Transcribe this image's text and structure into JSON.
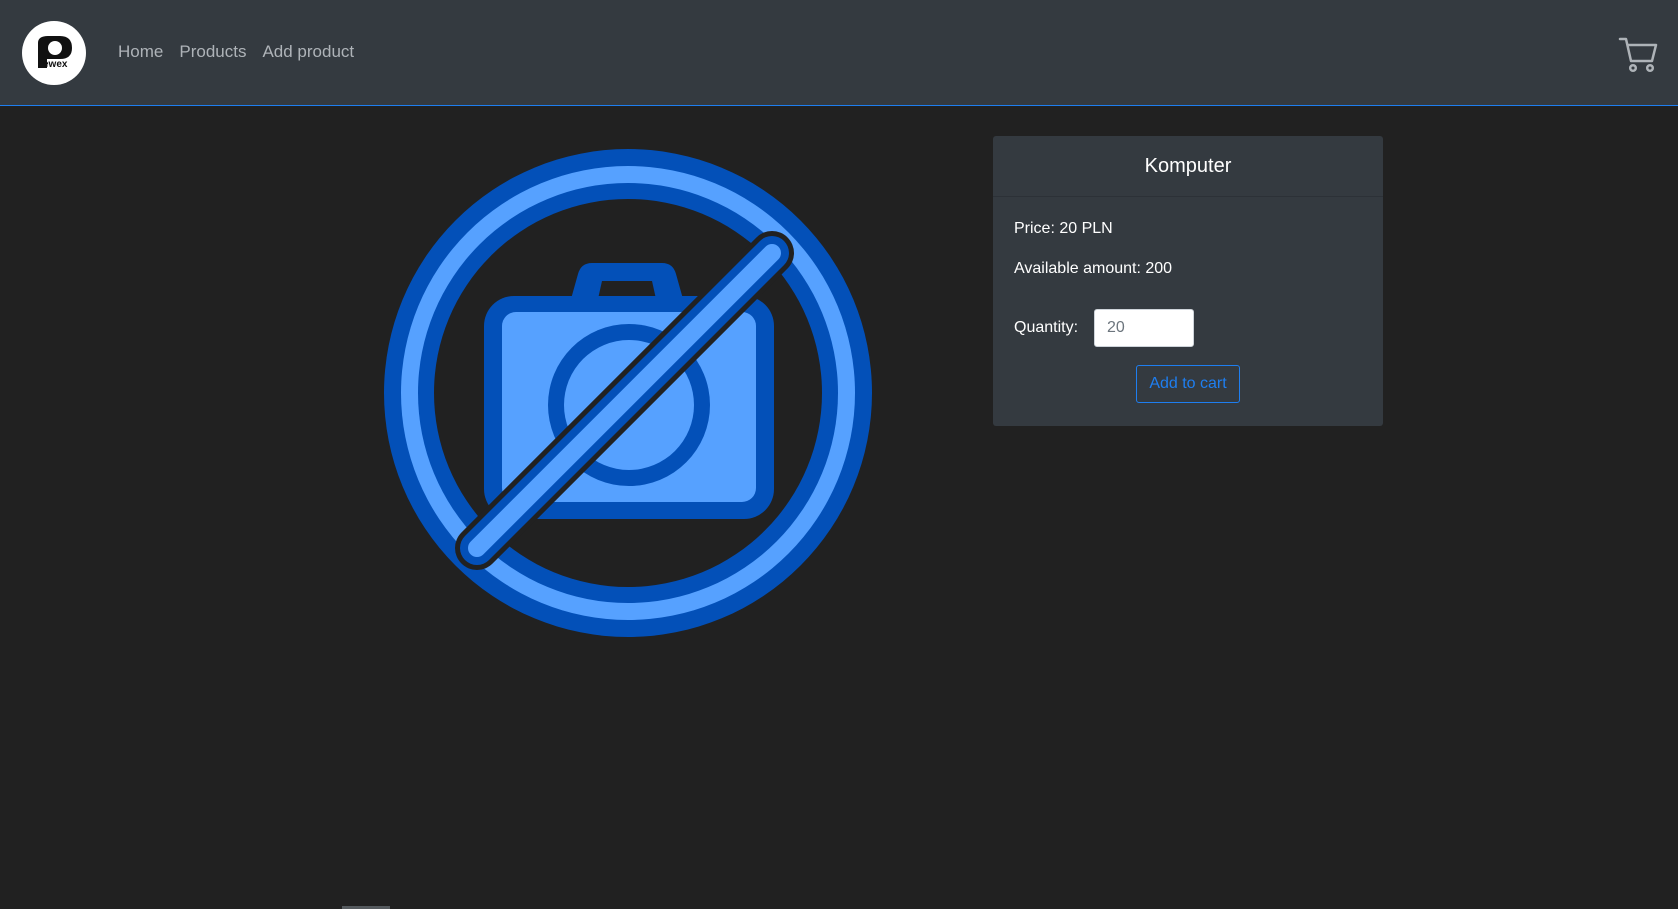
{
  "navbar": {
    "logo_icon": "pewex-logo-icon",
    "logo_text": "Pewex",
    "links": [
      {
        "label": "Home"
      },
      {
        "label": "Products"
      },
      {
        "label": "Add product"
      }
    ],
    "cart_icon": "shopping-cart-icon"
  },
  "product": {
    "image_icon": "no-photo-camera-icon",
    "name": "Komputer",
    "price_text": "Price: 20 PLN",
    "available_text": "Available amount: 200",
    "quantity_label": "Quantity:",
    "quantity_value": "20",
    "add_to_cart_label": "Add to cart"
  },
  "colors": {
    "navbar_bg": "#343a40",
    "page_bg": "#212121",
    "accent": "#1e7ef0",
    "icon_dark_blue": "#0350b8",
    "icon_light_blue": "#56a1ff"
  }
}
